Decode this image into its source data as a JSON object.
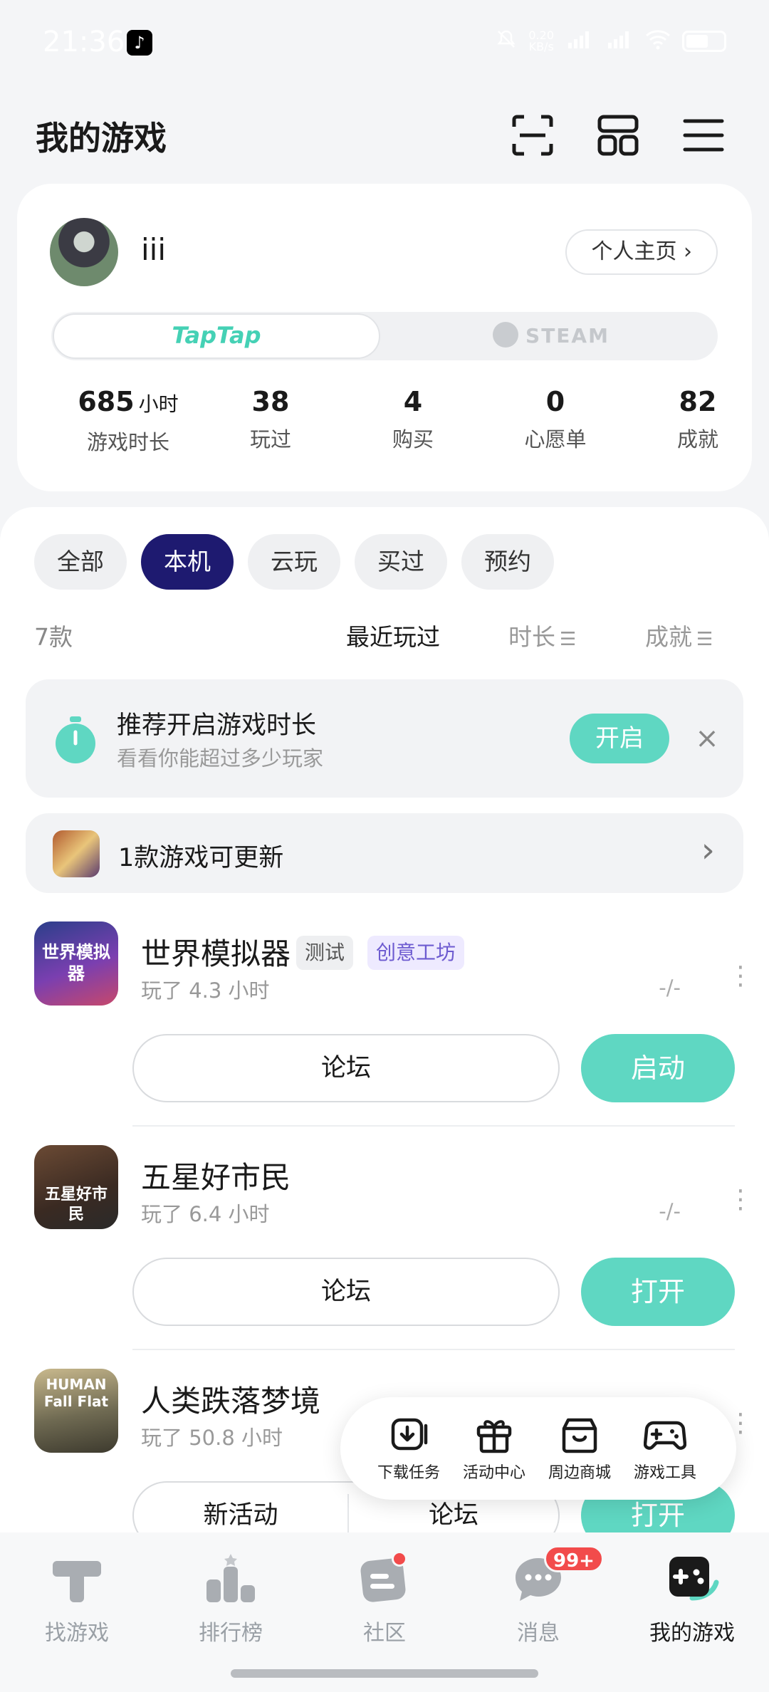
{
  "status_bar": {
    "time": "21:36",
    "net_speed_top": "0.20",
    "net_speed_unit": "KB/s",
    "signal_1": "5G",
    "signal_2": "5G"
  },
  "header": {
    "title": "我的游戏"
  },
  "profile": {
    "username": "iii",
    "profile_button": "个人主页 ›",
    "platforms": [
      {
        "label": "TapTap",
        "selected": true
      },
      {
        "label": "STEAM",
        "selected": false
      }
    ],
    "stats": [
      {
        "value": "685",
        "unit": "小时",
        "label": "游戏时长"
      },
      {
        "value": "38",
        "unit": "",
        "label": "玩过"
      },
      {
        "value": "4",
        "unit": "",
        "label": "购买"
      },
      {
        "value": "0",
        "unit": "",
        "label": "心愿单"
      },
      {
        "value": "82",
        "unit": "",
        "label": "成就"
      }
    ]
  },
  "filters": [
    {
      "label": "全部",
      "active": false
    },
    {
      "label": "本机",
      "active": true
    },
    {
      "label": "云玩",
      "active": false
    },
    {
      "label": "买过",
      "active": false
    },
    {
      "label": "预约",
      "active": false
    }
  ],
  "list_header": {
    "count": "7款",
    "sort_recent": "最近玩过",
    "sort_duration": "时长",
    "sort_achievement": "成就"
  },
  "tip": {
    "title": "推荐开启游戏时长",
    "subtitle": "看看你能超过多少玩家",
    "open_label": "开启",
    "close_glyph": "×"
  },
  "update_banner": {
    "text": "1款游戏可更新",
    "chevron": "›"
  },
  "games": [
    {
      "name": "世界模拟器",
      "tags": [
        "测试",
        "创意工坊"
      ],
      "playtime": "玩了 4.3 小时",
      "achievement": "-/-",
      "forum_label": "论坛",
      "action_label": "启动",
      "icon_text": "世界模拟器"
    },
    {
      "name": "五星好市民",
      "tags": [],
      "playtime": "玩了 6.4 小时",
      "achievement": "-/-",
      "forum_label": "论坛",
      "action_label": "打开",
      "icon_text": "五星好市民"
    },
    {
      "name": "人类跌落梦境",
      "tags": [],
      "playtime": "玩了 50.8 小时",
      "achievement": "",
      "event_label": "新活动",
      "forum_label": "论坛",
      "action_label": "打开",
      "icon_text": "HUMAN Fall Flat"
    }
  ],
  "float_toolbar": [
    {
      "label": "下载任务",
      "icon": "download-icon"
    },
    {
      "label": "活动中心",
      "icon": "gift-icon"
    },
    {
      "label": "周边商城",
      "icon": "shop-icon"
    },
    {
      "label": "游戏工具",
      "icon": "gamepad-icon"
    }
  ],
  "bottom_nav": [
    {
      "label": "找游戏",
      "icon": "taptap-logo-icon",
      "active": false
    },
    {
      "label": "排行榜",
      "icon": "ranking-icon",
      "active": false
    },
    {
      "label": "社区",
      "icon": "community-icon",
      "active": false,
      "dot": true
    },
    {
      "label": "消息",
      "icon": "message-icon",
      "active": false,
      "badge": "99+"
    },
    {
      "label": "我的游戏",
      "icon": "my-games-icon",
      "active": true
    }
  ],
  "colors": {
    "accent_green": "#5fd7c2",
    "active_chip": "#1e1a70",
    "badge_red": "#f24b4b",
    "taptap_brand": "#45d1b5"
  }
}
